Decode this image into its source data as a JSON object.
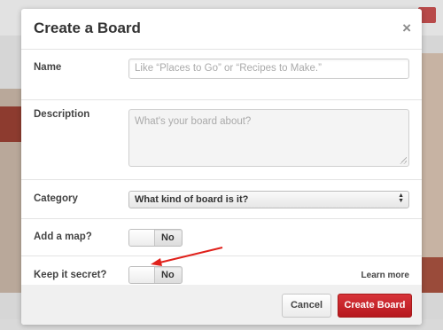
{
  "dialog": {
    "title": "Create a Board",
    "close_glyph": "×"
  },
  "fields": {
    "name": {
      "label": "Name",
      "placeholder": "Like “Places to Go” or “Recipes to Make.”"
    },
    "description": {
      "label": "Description",
      "placeholder": "What's your board about?"
    },
    "category": {
      "label": "Category",
      "selected": "What kind of board is it?"
    },
    "map": {
      "label": "Add a map?",
      "toggle_value": "No"
    },
    "secret": {
      "label": "Keep it secret?",
      "toggle_value": "No",
      "learn_more": "Learn more"
    }
  },
  "footer": {
    "cancel_label": "Cancel",
    "create_label": "Create Board"
  },
  "colors": {
    "create_button": "#c92228",
    "annotation_arrow": "#e0211b"
  },
  "icons": {
    "close": "close-icon",
    "select_arrows": "select-arrows-icon"
  }
}
